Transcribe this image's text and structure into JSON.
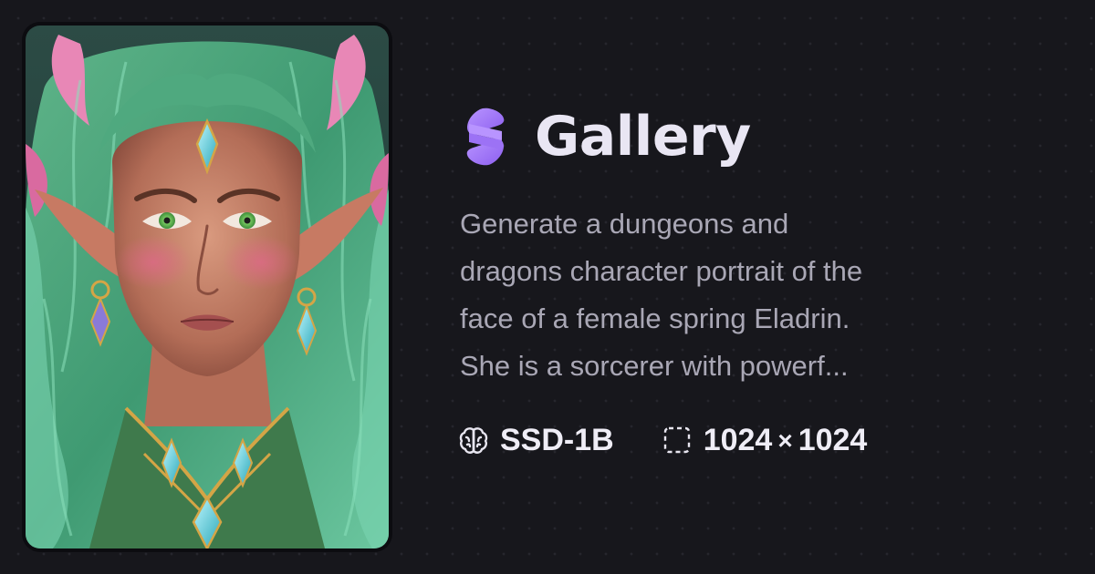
{
  "brand": {
    "logo_icon": "gallery-logo-icon",
    "title": "Gallery",
    "accent_color": "#a57ef5"
  },
  "image": {
    "subject": "fantasy elf portrait with green hair and pink horns"
  },
  "prompt": {
    "lines": [
      "Generate a dungeons and",
      "dragons character portrait of the",
      "face of a female spring Eladrin.",
      "She is a sorcerer with powerf..."
    ]
  },
  "meta": {
    "model_icon": "brain-icon",
    "model": "SSD-1B",
    "size_icon": "dashed-square-icon",
    "width": "1024",
    "times": "×",
    "height": "1024"
  }
}
